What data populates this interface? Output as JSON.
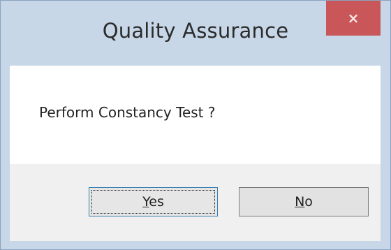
{
  "dialog": {
    "title": "Quality Assurance",
    "close_icon": "close-icon",
    "close_glyph": "×",
    "message": "Perform Constancy Test ?",
    "buttons": {
      "yes": {
        "mnemonic": "Y",
        "rest": "es"
      },
      "no": {
        "mnemonic": "N",
        "rest": "o"
      }
    }
  },
  "colors": {
    "frame": "#c7d7e8",
    "close_button": "#c9575a",
    "content_bg": "#ffffff",
    "footer_bg": "#f0f0f0",
    "default_button_border": "#3c7fb1"
  }
}
